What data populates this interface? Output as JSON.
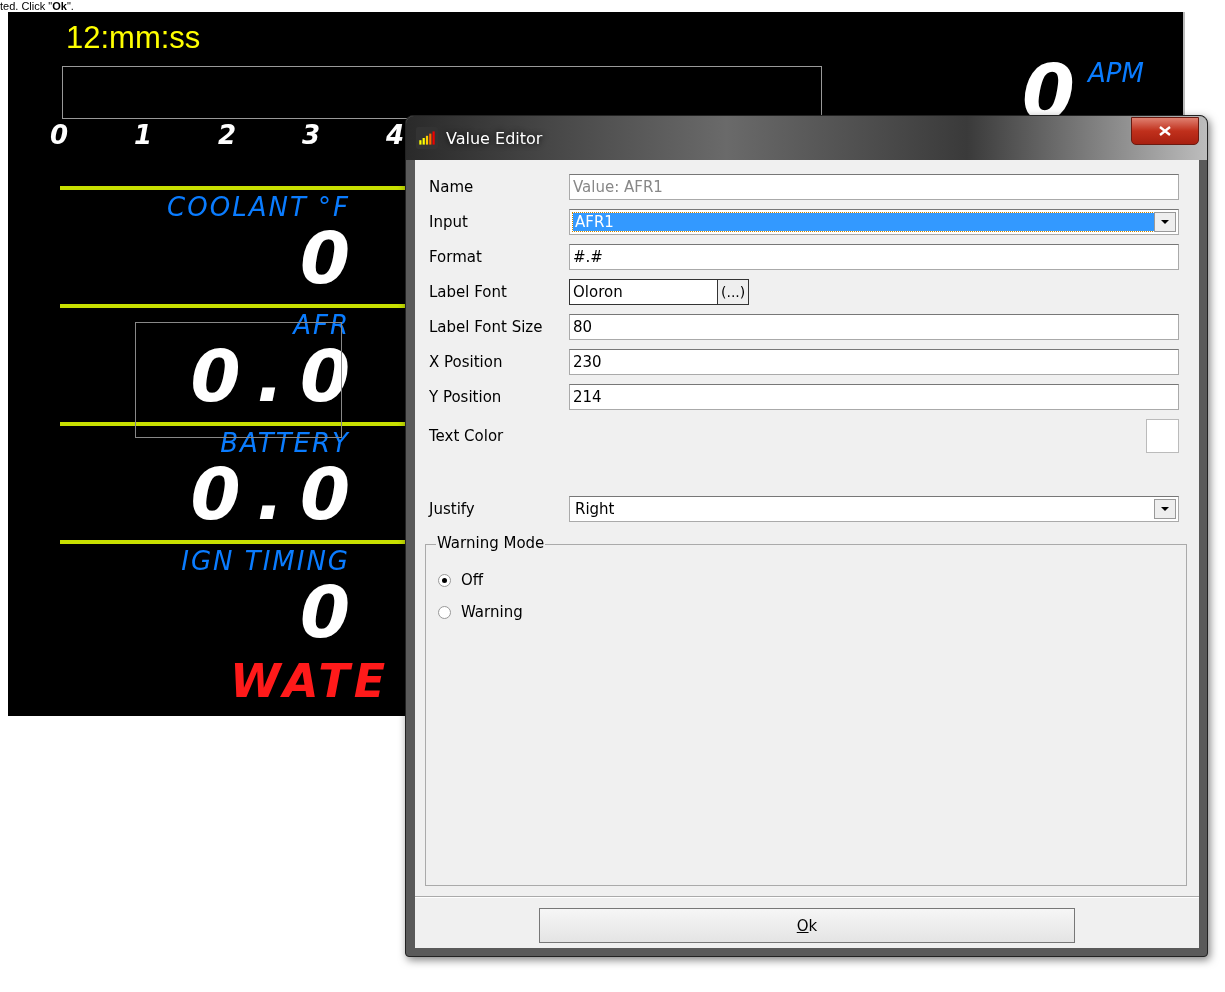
{
  "instruction": "ted. Click \"**Ok**\".",
  "dashboard": {
    "clock": "12:mm:ss",
    "scale": [
      "0",
      "1",
      "2",
      "3",
      "4"
    ],
    "rpm": {
      "value": "0",
      "unit": "APM"
    },
    "gauges": [
      {
        "label": "COOLANT °F",
        "value": "0",
        "selected": false
      },
      {
        "label": "AFR",
        "value": "0.0",
        "selected": true
      },
      {
        "label": "BATTERY",
        "value": "0.0",
        "selected": false
      },
      {
        "label": "IGN TIMING",
        "value": "0",
        "selected": false
      }
    ],
    "warning": "WATE"
  },
  "dialog": {
    "title": "Value Editor",
    "fields": [
      {
        "kind": "text",
        "label": "Name",
        "value": "Value: AFR1",
        "disabled": true
      },
      {
        "kind": "combo",
        "label": "Input",
        "value": "AFR1",
        "highlighted": true
      },
      {
        "kind": "text",
        "label": "Format",
        "value": "#.#",
        "disabled": false
      },
      {
        "kind": "font",
        "label": "Label Font",
        "value": "Oloron",
        "button": "(...)"
      },
      {
        "kind": "text",
        "label": "Label Font Size",
        "value": "80",
        "disabled": false
      },
      {
        "kind": "text",
        "label": "X Position",
        "value": "230",
        "disabled": false
      },
      {
        "kind": "text",
        "label": "Y Position",
        "value": "214",
        "disabled": false
      },
      {
        "kind": "color",
        "label": "Text Color",
        "color": "#ffffff"
      },
      {
        "kind": "combo",
        "label": "Justify",
        "value": "Right",
        "highlighted": false
      }
    ],
    "warning_mode": {
      "title": "Warning Mode",
      "options": [
        {
          "label": "Off",
          "selected": true
        },
        {
          "label": "Warning",
          "selected": false
        }
      ]
    },
    "ok_button": "Ok"
  }
}
